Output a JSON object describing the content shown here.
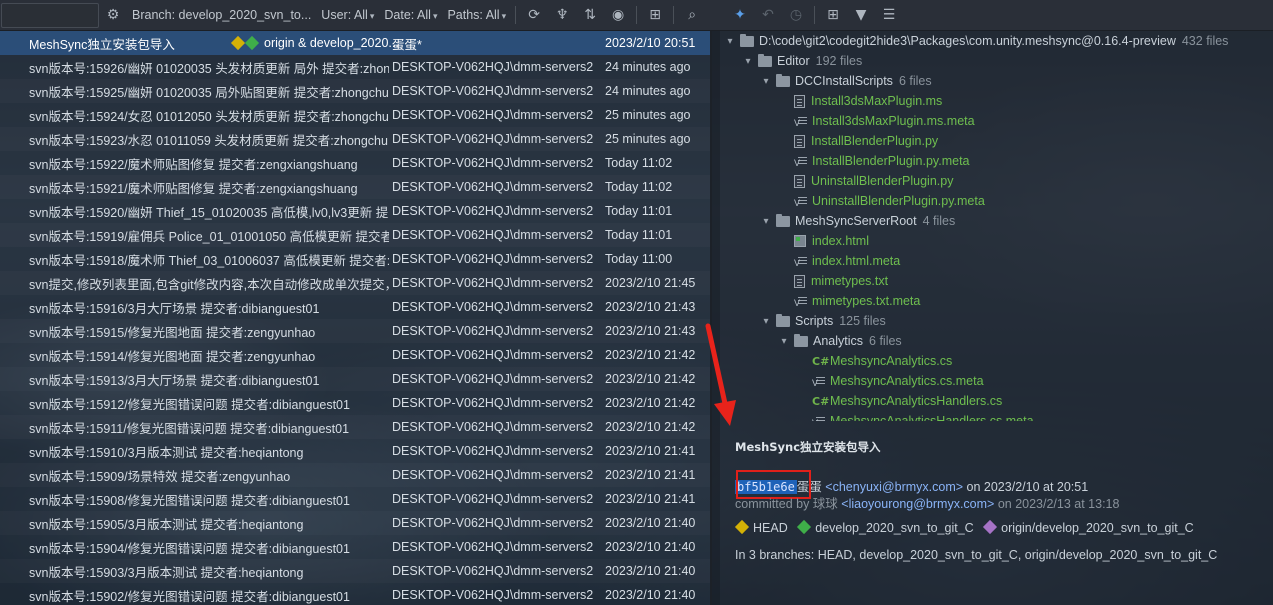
{
  "toolbar": {
    "branch_label": "Branch: develop_2020_svn_to...",
    "user_label": "User: All",
    "date_label": "Date: All",
    "paths_label": "Paths: All"
  },
  "commits": [
    {
      "message": "MeshSync独立安装包导入",
      "tags": "origin & develop_2020...",
      "author": "蛋蛋*",
      "date": "2023/2/10 20:51",
      "selected": true
    },
    {
      "message": "svn版本号:15926/幽妍 01020035 头发材质更新 局外  提交者:zhon",
      "author": "DESKTOP-V062HQJ\\dmm-servers2",
      "date": "24 minutes ago"
    },
    {
      "message": "svn版本号:15925/幽妍 01020035 局外贴图更新  提交者:zhongchu",
      "author": "DESKTOP-V062HQJ\\dmm-servers2",
      "date": "24 minutes ago"
    },
    {
      "message": "svn版本号:15924/女忍 01012050 头发材质更新  提交者:zhongchu",
      "author": "DESKTOP-V062HQJ\\dmm-servers2",
      "date": "25 minutes ago"
    },
    {
      "message": "svn版本号:15923/水忍 01011059 头发材质更新  提交者:zhongchu",
      "author": "DESKTOP-V062HQJ\\dmm-servers2",
      "date": "25 minutes ago"
    },
    {
      "message": "svn版本号:15922/魔术师贴图修复  提交者:zengxiangshuang",
      "author": "DESKTOP-V062HQJ\\dmm-servers2",
      "date": "Today 11:02"
    },
    {
      "message": "svn版本号:15921/魔术师贴图修复  提交者:zengxiangshuang",
      "author": "DESKTOP-V062HQJ\\dmm-servers2",
      "date": "Today 11:02"
    },
    {
      "message": "svn版本号:15920/幽妍 Thief_15_01020035 高低模,lv0,lv3更新  提交",
      "author": "DESKTOP-V062HQJ\\dmm-servers2",
      "date": "Today 11:01"
    },
    {
      "message": "svn版本号:15919/雇佣兵 Police_01_01001050 高低模更新  提交者",
      "author": "DESKTOP-V062HQJ\\dmm-servers2",
      "date": "Today 11:01"
    },
    {
      "message": "svn版本号:15918/魔术师 Thief_03_01006037 高低模更新  提交者:zh",
      "author": "DESKTOP-V062HQJ\\dmm-servers2",
      "date": "Today 11:00"
    },
    {
      "message": "svn提交,修改列表里面,包含git修改内容,本次自动修改成单次提交，从",
      "author": "DESKTOP-V062HQJ\\dmm-servers2",
      "date": "2023/2/10 21:45"
    },
    {
      "message": "svn版本号:15916/3月大厅场景  提交者:dibianguest01",
      "author": "DESKTOP-V062HQJ\\dmm-servers2",
      "date": "2023/2/10 21:43"
    },
    {
      "message": "svn版本号:15915/修复光图地面  提交者:zengyunhao",
      "author": "DESKTOP-V062HQJ\\dmm-servers2",
      "date": "2023/2/10 21:43"
    },
    {
      "message": "svn版本号:15914/修复光图地面  提交者:zengyunhao",
      "author": "DESKTOP-V062HQJ\\dmm-servers2",
      "date": "2023/2/10 21:42"
    },
    {
      "message": "svn版本号:15913/3月大厅场景  提交者:dibianguest01",
      "author": "DESKTOP-V062HQJ\\dmm-servers2",
      "date": "2023/2/10 21:42"
    },
    {
      "message": "svn版本号:15912/修复光图错误问题  提交者:dibianguest01",
      "author": "DESKTOP-V062HQJ\\dmm-servers2",
      "date": "2023/2/10 21:42"
    },
    {
      "message": "svn版本号:15911/修复光图错误问题  提交者:dibianguest01",
      "author": "DESKTOP-V062HQJ\\dmm-servers2",
      "date": "2023/2/10 21:42"
    },
    {
      "message": "svn版本号:15910/3月版本测试  提交者:heqiantong",
      "author": "DESKTOP-V062HQJ\\dmm-servers2",
      "date": "2023/2/10 21:41"
    },
    {
      "message": "svn版本号:15909/场景特效  提交者:zengyunhao",
      "author": "DESKTOP-V062HQJ\\dmm-servers2",
      "date": "2023/2/10 21:41"
    },
    {
      "message": "svn版本号:15908/修复光图错误问题  提交者:dibianguest01",
      "author": "DESKTOP-V062HQJ\\dmm-servers2",
      "date": "2023/2/10 21:41"
    },
    {
      "message": "svn版本号:15905/3月版本测试  提交者:heqiantong",
      "author": "DESKTOP-V062HQJ\\dmm-servers2",
      "date": "2023/2/10 21:40"
    },
    {
      "message": "svn版本号:15904/修复光图错误问题  提交者:dibianguest01",
      "author": "DESKTOP-V062HQJ\\dmm-servers2",
      "date": "2023/2/10 21:40"
    },
    {
      "message": "svn版本号:15903/3月版本测试  提交者:heqiantong",
      "author": "DESKTOP-V062HQJ\\dmm-servers2",
      "date": "2023/2/10 21:40"
    },
    {
      "message": "svn版本号:15902/修复光图错误问题  提交者:dibianguest01",
      "author": "DESKTOP-V062HQJ\\dmm-servers2",
      "date": "2023/2/10 21:40"
    }
  ],
  "tree": [
    {
      "level": 0,
      "kind": "folder",
      "open": true,
      "name": "D:\\code\\git2\\codegit2hide3\\Packages\\com.unity.meshsync@0.16.4-preview",
      "count": "432 files",
      "color": "white"
    },
    {
      "level": 1,
      "kind": "folder",
      "open": true,
      "name": "Editor",
      "count": "192 files",
      "color": "white"
    },
    {
      "level": 2,
      "kind": "folder",
      "open": true,
      "name": "DCCInstallScripts",
      "count": "6 files",
      "color": "white"
    },
    {
      "level": 3,
      "kind": "file",
      "name": "Install3dsMaxPlugin.ms",
      "color": "green"
    },
    {
      "level": 3,
      "kind": "meta",
      "name": "Install3dsMaxPlugin.ms.meta",
      "color": "green"
    },
    {
      "level": 3,
      "kind": "file",
      "name": "InstallBlenderPlugin.py",
      "color": "green"
    },
    {
      "level": 3,
      "kind": "meta",
      "name": "InstallBlenderPlugin.py.meta",
      "color": "green"
    },
    {
      "level": 3,
      "kind": "file",
      "name": "UninstallBlenderPlugin.py",
      "color": "green"
    },
    {
      "level": 3,
      "kind": "meta",
      "name": "UninstallBlenderPlugin.py.meta",
      "color": "green"
    },
    {
      "level": 2,
      "kind": "folder",
      "open": true,
      "name": "MeshSyncServerRoot",
      "count": "4 files",
      "color": "white"
    },
    {
      "level": 3,
      "kind": "html",
      "name": "index.html",
      "color": "green"
    },
    {
      "level": 3,
      "kind": "meta",
      "name": "index.html.meta",
      "color": "green"
    },
    {
      "level": 3,
      "kind": "file",
      "name": "mimetypes.txt",
      "color": "green"
    },
    {
      "level": 3,
      "kind": "meta",
      "name": "mimetypes.txt.meta",
      "color": "green"
    },
    {
      "level": 2,
      "kind": "folder",
      "open": true,
      "name": "Scripts",
      "count": "125 files",
      "color": "white"
    },
    {
      "level": 3,
      "kind": "folder",
      "open": true,
      "name": "Analytics",
      "count": "6 files",
      "color": "white"
    },
    {
      "level": 4,
      "kind": "cs",
      "name": "MeshsyncAnalytics.cs",
      "color": "green"
    },
    {
      "level": 4,
      "kind": "meta",
      "name": "MeshsyncAnalytics.cs.meta",
      "color": "green"
    },
    {
      "level": 4,
      "kind": "cs",
      "name": "MeshsyncAnalyticsHandlers.cs",
      "color": "green"
    },
    {
      "level": 4,
      "kind": "meta",
      "name": "MeshsyncAnalyticsHandlers.cs.meta",
      "color": "green"
    }
  ],
  "details": {
    "title": "MeshSync独立安装包导入",
    "hash": "bf5b1e6e",
    "author": "蛋蛋",
    "author_email": "<chenyuxi@brmyx.com>",
    "author_date": "on 2023/2/10 at 20:51",
    "committed_by_label": "committed by 球球",
    "committer_email": "<liaoyourong@brmyx.com>",
    "committer_date": "on 2023/2/13 at 13:18",
    "ref_head": "HEAD",
    "ref_local": "develop_2020_svn_to_git_C",
    "ref_remote": "origin/develop_2020_svn_to_git_C",
    "branches": "In 3 branches: HEAD, develop_2020_svn_to_git_C, origin/develop_2020_svn_to_git_C"
  }
}
